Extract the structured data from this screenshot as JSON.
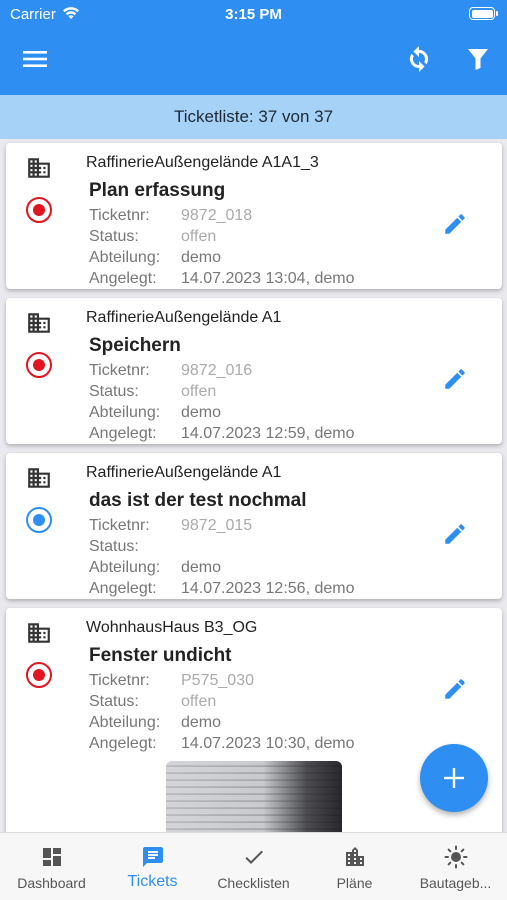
{
  "status_bar": {
    "carrier": "Carrier",
    "time": "3:15 PM"
  },
  "header": {
    "menu_icon": "hamburger-menu-icon",
    "sync_icon": "sync-icon",
    "filter_icon": "filter-icon"
  },
  "subheader": {
    "text": "Ticketliste: 37 von 37"
  },
  "labels": {
    "ticketnr": "Ticketnr:",
    "status": "Status:",
    "abteilung": "Abteilung:",
    "angelegt": "Angelegt:"
  },
  "tickets": [
    {
      "location": "RaffinerieAußengelände A1A1_3",
      "title": "Plan erfassung",
      "ticketnr": "9872_018",
      "status": "offen",
      "abteilung": "demo",
      "angelegt": "14.07.2023 13:04, demo",
      "status_color": "#e0151f"
    },
    {
      "location": "RaffinerieAußengelände A1",
      "title": "Speichern",
      "ticketnr": "9872_016",
      "status": "offen",
      "abteilung": "demo",
      "angelegt": "14.07.2023 12:59, demo",
      "status_color": "#e0151f"
    },
    {
      "location": "RaffinerieAußengelände A1",
      "title": "das ist der test nochmal",
      "ticketnr": "9872_015",
      "status": "",
      "abteilung": "demo",
      "angelegt": "14.07.2023 12:56, demo",
      "status_color": "#2f8ef2"
    },
    {
      "location": "WohnhausHaus B3_OG",
      "title": "Fenster undicht",
      "ticketnr": "P575_030",
      "status": "offen",
      "abteilung": "demo",
      "angelegt": "14.07.2023 10:30, demo",
      "status_color": "#e0151f"
    }
  ],
  "fab": {
    "icon": "plus-icon"
  },
  "tabs": [
    {
      "label": "Dashboard",
      "icon": "dashboard-icon"
    },
    {
      "label": "Tickets",
      "icon": "ticket-icon"
    },
    {
      "label": "Checklisten",
      "icon": "checkmark-icon"
    },
    {
      "label": "Pläne",
      "icon": "building-icon"
    },
    {
      "label": "Bautageb...",
      "icon": "sun-icon"
    }
  ],
  "colors": {
    "primary": "#2f8ef2",
    "subheader": "#a7d2f7",
    "open_status": "#e0151f",
    "in_progress_status": "#2f8ef2"
  }
}
